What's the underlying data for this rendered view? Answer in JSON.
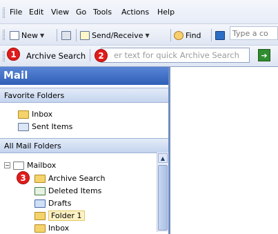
{
  "menubar": {
    "items": [
      "File",
      "Edit",
      "View",
      "Go",
      "Tools",
      "Actions",
      "Help"
    ]
  },
  "toolbar": {
    "new_label": "New",
    "send_receive_label": "Send/Receive",
    "find_label": "Find",
    "contact_placeholder": "Type a co"
  },
  "search": {
    "badge1": "1",
    "badge2": "2",
    "button_label": "Archive Search",
    "placeholder": "er text for quick Archive Search",
    "go_icon": "arrow-right-icon"
  },
  "navpane": {
    "title": "Mail",
    "favorites_header": "Favorite Folders",
    "favorites": [
      "Inbox",
      "Sent Items"
    ],
    "all_header": "All Mail Folders",
    "root": "Mailbox",
    "badge3": "3",
    "folders": [
      "Archive Search",
      "Deleted Items",
      "Drafts",
      "Folder 1",
      "Inbox"
    ],
    "selected": "Folder 1"
  },
  "colors": {
    "accent": "#2f5fb8",
    "badge": "#e11b1b",
    "selection": "#fdf2c4"
  }
}
